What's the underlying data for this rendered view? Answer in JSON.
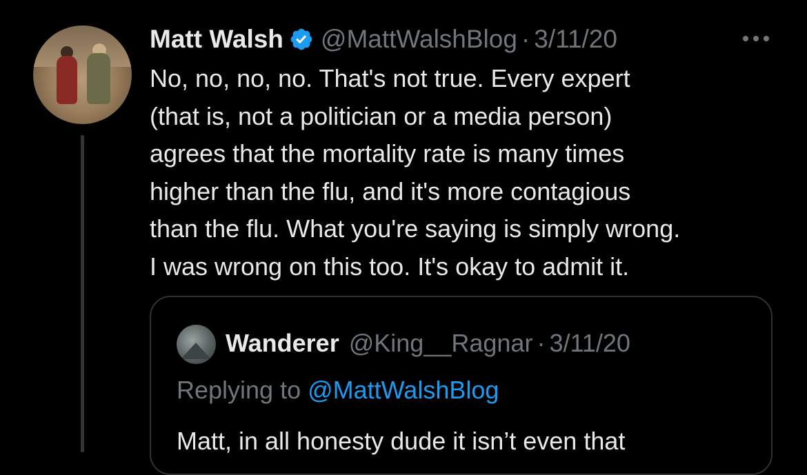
{
  "tweet": {
    "author_name": "Matt Walsh",
    "author_handle": "@MattWalshBlog",
    "separator": "·",
    "date": "3/11/20",
    "text": "No, no, no, no. That's not true. Every expert\n(that is, not a politician or a media person)\nagrees that the mortality rate is many times\nhigher than the flu, and it's more contagious\nthan the flu. What you're saying is simply wrong.\nI was wrong on this too. It's okay to admit it.",
    "verified": true
  },
  "quoted_tweet": {
    "author_name": "Wanderer",
    "author_handle": "@King__Ragnar",
    "separator": "·",
    "date": "3/11/20",
    "replying_label": "Replying to",
    "replying_mention": "@MattWalshBlog",
    "text": "Matt, in all honesty dude it isn’t even that"
  },
  "colors": {
    "background": "#000000",
    "primary_text": "#e7e9ea",
    "secondary_text": "#71767b",
    "accent": "#1d9bf0",
    "border": "#2f3336"
  },
  "icons": {
    "verified": "verified-badge-icon",
    "more": "more-horizontal-icon"
  }
}
